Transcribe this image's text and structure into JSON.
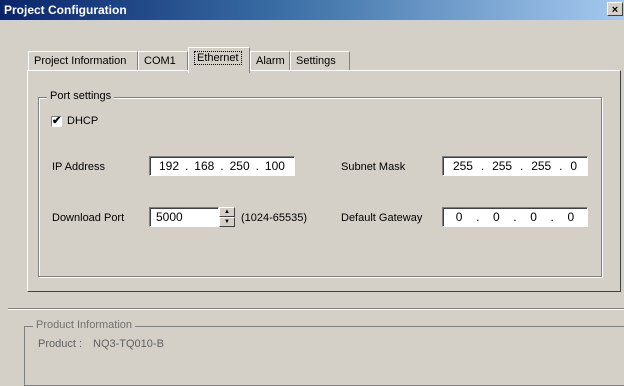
{
  "window": {
    "title": "Project Configuration",
    "close_glyph": "×"
  },
  "tabs": [
    {
      "label": "Project Information"
    },
    {
      "label": "COM1"
    },
    {
      "label": "Ethernet",
      "active": true
    },
    {
      "label": "Alarm"
    },
    {
      "label": "Settings"
    }
  ],
  "port_settings": {
    "legend": "Port settings",
    "dhcp_label": "DHCP",
    "dhcp_checked": true,
    "dhcp_check_glyph": "✔",
    "ip_address_label": "IP Address",
    "ip_address": [
      "192",
      "168",
      "250",
      "100"
    ],
    "subnet_mask_label": "Subnet Mask",
    "subnet_mask": [
      "255",
      "255",
      "255",
      "0"
    ],
    "download_port_label": "Download Port",
    "download_port_value": "5000",
    "download_port_range": "(1024-65535)",
    "default_gateway_label": "Default Gateway",
    "default_gateway": [
      "0",
      "0",
      "0",
      "0"
    ]
  },
  "product_info": {
    "legend": "Product Information",
    "product_label": "Product :",
    "product_value": "NQ3-TQ010-B"
  },
  "icons": {
    "close": "close-icon",
    "spin_up": "spin-up-arrow-icon",
    "spin_down": "spin-down-arrow-icon",
    "checkbox": "checkmark-icon"
  },
  "colors": {
    "window_bg": "#d4d0c8",
    "title_start": "#0a246a",
    "title_end": "#a6caf0"
  }
}
